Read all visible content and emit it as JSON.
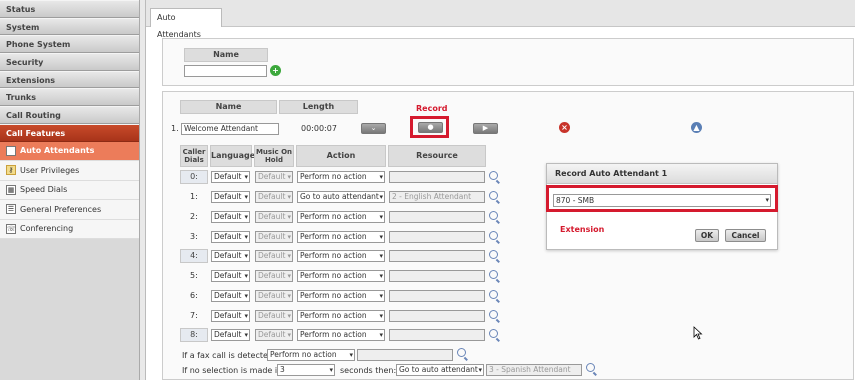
{
  "sidebar": {
    "items": [
      "Status",
      "System",
      "Phone System",
      "Security",
      "Extensions",
      "Trunks",
      "Call Routing",
      "Call Features"
    ],
    "sub_items": [
      "Auto Attendants",
      "User Privileges",
      "Speed Dials",
      "General Preferences",
      "Conferencing"
    ]
  },
  "tab": {
    "label": "Auto Attendants"
  },
  "name_box": {
    "header": "Name",
    "value": ""
  },
  "list": {
    "name_header": "Name",
    "length_header": "Length",
    "record_label": "Record",
    "index": "1.",
    "name_value": "Welcome Attendant",
    "length_value": "00:00:07"
  },
  "table": {
    "headers": [
      "Caller\nDials",
      "Language",
      "Music On\nHold",
      "Action",
      "Resource"
    ],
    "rows": [
      {
        "dial": "0:",
        "lang": "Default",
        "moh": "Default",
        "action": "Perform no action",
        "resource": ""
      },
      {
        "dial": "1:",
        "lang": "Default",
        "moh": "Default",
        "action": "Go to auto attendant",
        "resource": "2 - English Attendant"
      },
      {
        "dial": "2:",
        "lang": "Default",
        "moh": "Default",
        "action": "Perform no action",
        "resource": ""
      },
      {
        "dial": "3:",
        "lang": "Default",
        "moh": "Default",
        "action": "Perform no action",
        "resource": ""
      },
      {
        "dial": "4:",
        "lang": "Default",
        "moh": "Default",
        "action": "Perform no action",
        "resource": ""
      },
      {
        "dial": "5:",
        "lang": "Default",
        "moh": "Default",
        "action": "Perform no action",
        "resource": ""
      },
      {
        "dial": "6:",
        "lang": "Default",
        "moh": "Default",
        "action": "Perform no action",
        "resource": ""
      },
      {
        "dial": "7:",
        "lang": "Default",
        "moh": "Default",
        "action": "Perform no action",
        "resource": ""
      },
      {
        "dial": "8:",
        "lang": "Default",
        "moh": "Default",
        "action": "Perform no action",
        "resource": ""
      }
    ]
  },
  "fax": {
    "label": "If a fax call is detected:",
    "action": "Perform no action",
    "resource": ""
  },
  "noselect": {
    "label": "If no selection is made in:",
    "seconds": "3",
    "then_label": "seconds then:",
    "action": "Go to auto attendant",
    "resource": "3 - Spanish Attendant"
  },
  "dialog": {
    "title": "Record Auto Attendant 1",
    "extension_value": "870 - SMB",
    "extension_label": "Extension",
    "ok_label": "OK",
    "cancel_label": "Cancel"
  },
  "colors": {
    "accent": "#c84a2a",
    "highlight": "#d51a2e",
    "sub_active": "#ec7c5a"
  }
}
